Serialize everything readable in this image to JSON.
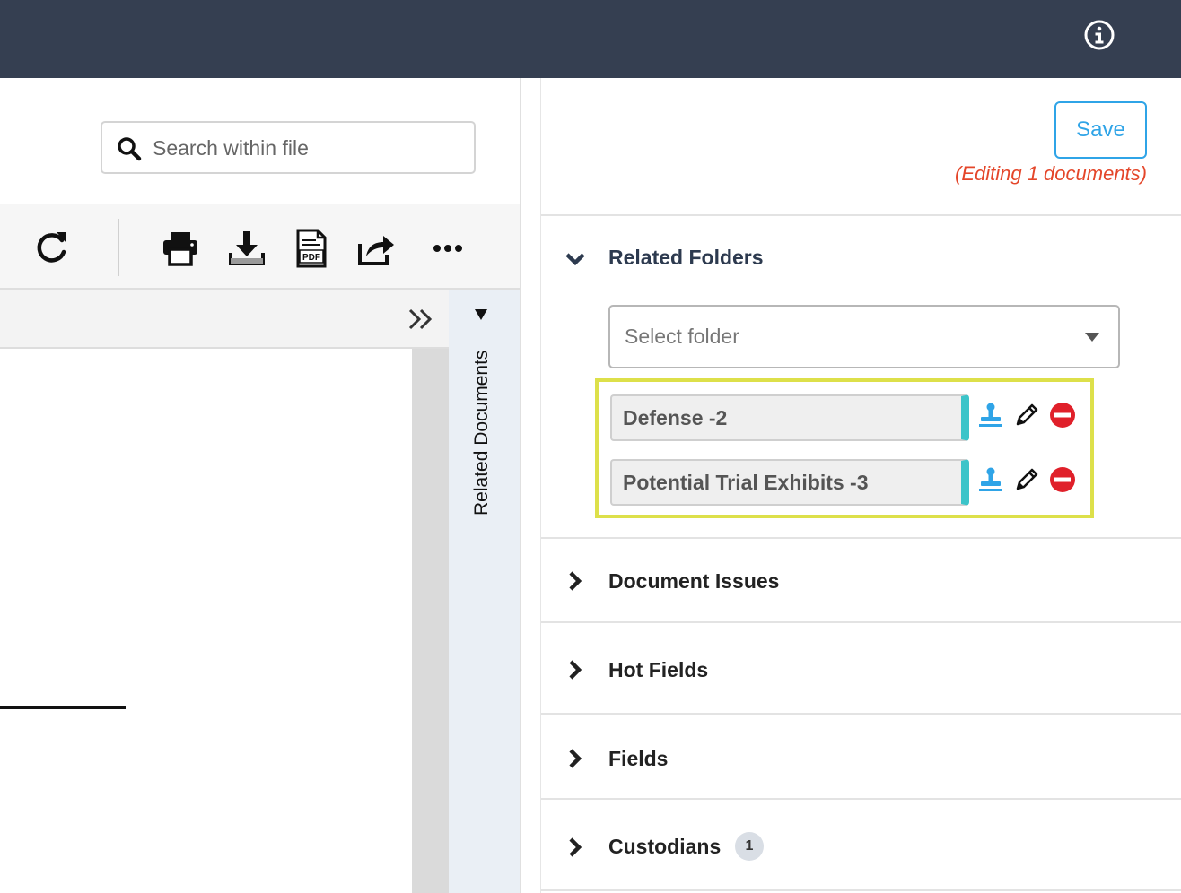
{
  "header": {
    "info_icon": "info-circle-icon"
  },
  "viewer": {
    "search": {
      "placeholder": "Search within file",
      "value": ""
    },
    "toolbar": {
      "icons": [
        "refresh-icon",
        "print-icon",
        "download-icon",
        "pdf-icon",
        "share-icon",
        "more-icon"
      ]
    },
    "related_documents_tab": {
      "label": "Related Documents"
    }
  },
  "panel": {
    "save_label": "Save",
    "editing_note": "(Editing 1 documents)",
    "sections": [
      {
        "title": "Related Folders",
        "expanded": true
      },
      {
        "title": "Document Issues",
        "expanded": false
      },
      {
        "title": "Hot Fields",
        "expanded": false
      },
      {
        "title": "Fields",
        "expanded": false
      },
      {
        "title": "Custodians",
        "expanded": false,
        "badge": "1"
      }
    ],
    "folder_select": {
      "placeholder": "Select folder"
    },
    "folders": [
      {
        "name": "Defense -2"
      },
      {
        "name": "Potential Trial Exhibits -3"
      }
    ]
  },
  "colors": {
    "header_bg": "#353f51",
    "accent_blue": "#2fa4e7",
    "editing_red": "#e4462a",
    "folder_bar_teal": "#3cc4c9",
    "highlight_yellow": "#dde04a",
    "remove_red": "#e0202a"
  }
}
